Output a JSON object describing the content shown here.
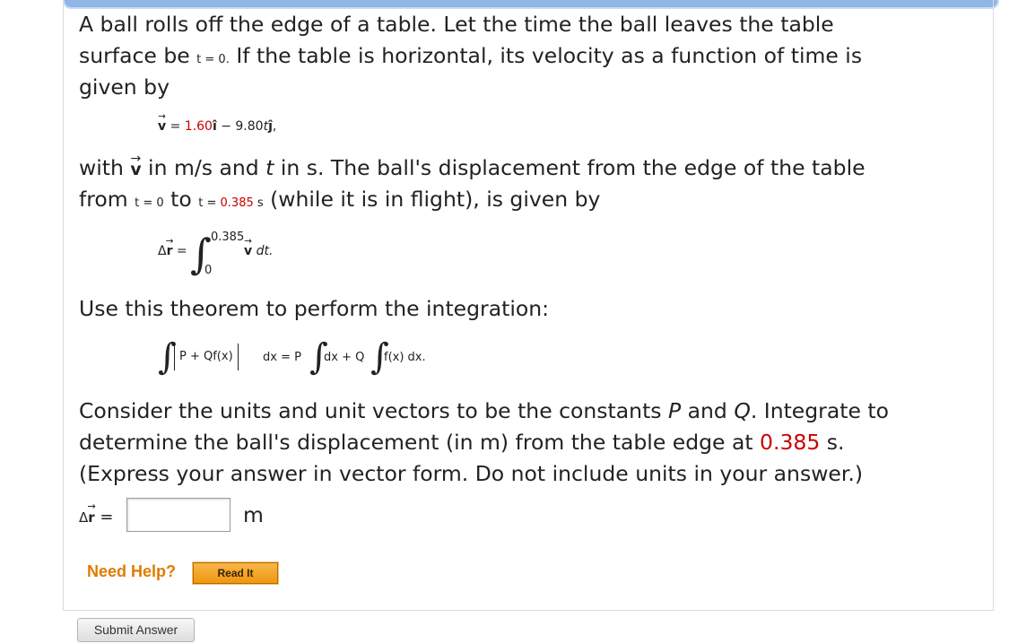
{
  "problem": {
    "p1_line1": "A ball rolls off the edge of a table. Let the time the ball leaves the table",
    "p1_line2_a": "surface be ",
    "p1_t0": "t = 0.",
    "p1_line2_b": " If the table is horizontal, its velocity as a function of time is",
    "p1_line3": "given by",
    "velocity_eq": {
      "v_symbol": "v",
      "equals": " = ",
      "coef_x": "1.60",
      "i_hat": "î",
      "minus": " − 9.80",
      "t": "t",
      "j_hat": "ĵ",
      "comma": ","
    },
    "p2_line1_a": "with ",
    "p2_v": "v",
    "p2_line1_b": " in m/s and ",
    "p2_t": "t",
    "p2_line1_c": " in s. The ball's displacement from the edge of the table",
    "p2_line2_a": "from ",
    "p2_t_eq0": "t = 0",
    "p2_to": " to ",
    "p2_t_eq_a": "t = ",
    "p2_t_val": "0.385",
    "p2_t_unit": " s",
    "p2_line2_b": " (while it is in flight), is given by",
    "disp_eq": {
      "lhs_delta": "Δ",
      "lhs_r": "r",
      "equals": " =",
      "integral_sign": "∫",
      "upper_limit": "0.385",
      "lower_limit": "0",
      "integrand_v": "v",
      "integrand_dt": " dt."
    },
    "p3": "Use this theorem to perform the integration:",
    "theorem": {
      "int1": "∫",
      "bracket_content": "P + Qf(x)",
      "dx1": " dx = P",
      "int2": "∫",
      "dx2": " dx + Q",
      "int3": "∫",
      "fx_dx": " f(x) dx."
    },
    "p4_line1_a": "Consider the units and unit vectors to be the constants ",
    "p4_P": "P",
    "p4_and": " and ",
    "p4_Q": "Q",
    "p4_line1_b": ". Integrate to",
    "p4_line2_a": "determine the ball's displacement (in m) from the table edge at ",
    "p4_val": "0.385",
    "p4_line2_b": " s.",
    "p4_line3": "(Express your answer in vector form. Do not include units in your answer.)"
  },
  "answer": {
    "label_delta": "Δ",
    "label_r": "r",
    "label_eq": " =",
    "input_value": "",
    "unit": "m"
  },
  "help": {
    "need_help": "Need Help?",
    "read_it": "Read It"
  },
  "submit_label": "Submit Answer",
  "colors": {
    "accent_red": "#cc0000",
    "help_orange": "#e07b00"
  }
}
